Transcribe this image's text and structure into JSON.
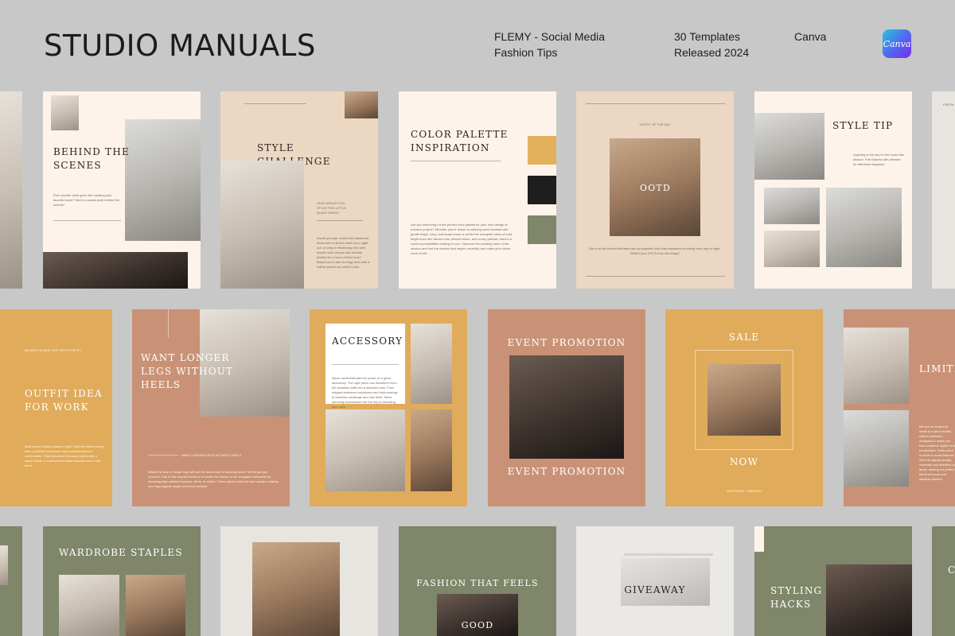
{
  "header": {
    "brand": "STUDIO MANUALS",
    "product_line1": "FLEMY - Social Media",
    "product_line2": "Fashion Tips",
    "templates": "30 Templates",
    "released": "Released 2024",
    "platform": "Canva",
    "logo_text": "Canva"
  },
  "row1": {
    "behind": {
      "title_l1": "BEHIND THE",
      "title_l2": "SCENES",
      "body": "Ever wonder what goes into creating your favorite looks? Here's a sneak peek behind the scenes!"
    },
    "style_challenge": {
      "title_l1": "STYLE",
      "title_l2": "CHALLENGE",
      "sub_l1": "HOW WOULD YOU",
      "sub_l2": "STYLE THIS LITTLE",
      "sub_l3": "BLACK DRESS",
      "body": "Would you pair it with bold statement heels and a vibrant clutch for a night out, or keep it effortlessly chic with simple nude pumps and delicate jewelry for a more refined look? Maybe you'd add an edgy twist with a leather jacket and ankle boots."
    },
    "palette": {
      "title_l1": "COLOR PALETTE",
      "title_l2": "INSPIRATION",
      "body": "Are you searching for the perfect color palette for your next design or creative project? Whether you're drawn to calming earth neutrals with gentle beige, ivory, and taupe tones or prefer the energetic vibes of bold, bright hues like vibrant reds, electric blues, and sunny yellows, there's a world of possibilities waiting for you. Discover the trending hues of the season and find the shades that inspire creativity and make your vision come to life.",
      "colors": [
        "#e3b15c",
        "#1e1e1e",
        "#7f8669"
      ]
    },
    "ootd": {
      "kicker": "OUTFIT OF THE DAY",
      "title": "OOTD",
      "body_l1": "We're all about that effortless yet put together look that transitions smoothly from day to night.",
      "body_l2": "What's your OOTD look like today?"
    },
    "style_tip": {
      "title": "STYLE TIP",
      "body": "Layering is the key to chic looks this season. Pair blazers with dresses for effortless elegance."
    },
    "partial_label": "FRESH"
  },
  "row2": {
    "outfit": {
      "kicker": "MONDAY BLUES? NOT WITH THIS FIT",
      "title_l1": "OUTFIT IDEA",
      "title_l2": "FOR WORK",
      "body": "Beat those Monday blues in style! Start the week strong with a polished look that's both professional and comfortable. Think structured trousers paired with a sleek blouse or a structured blazer layered over a chic dress."
    },
    "legs": {
      "title_l1": "WANT LONGER",
      "title_l2": "LEGS WITHOUT",
      "title_l3": "HEELS",
      "kicker": "WANT LONGER LEGS WITHOUT HEELS",
      "body": "Watch the look of longer legs without the discomfort of wearing heels? We've got you covered! One of the simplest tricks is to create the illusion of an elongated silhouette by choosing high-waisted trousers, skirts, or shorts. These pieces draw the eye upward, making your legs appear longer and more defined."
    },
    "accessory": {
      "title": "ACCESSORY",
      "body": "Never underestimate the power of a great accessory. The right piece can transform even the simplest outfit into a standout look. From elegant statement necklaces and bold earrings to timeless handbags and chic belts, these stunning accessories are the key to elevating your style."
    },
    "event": {
      "title_top": "EVENT PROMOTION",
      "title_bottom": "EVENT PROMOTION"
    },
    "sale": {
      "top": "SALE",
      "bottom": "NOW",
      "footer": "SHOP NOW · WEBSITE"
    },
    "limited": {
      "title": "LIMITE",
      "body": "We are so excited to share our latest limited edition collection designed to make you feel confident, stylish and comfortable. Each piece is made in small batches with the highest quality materials and attention to detail, making it a perfect blend of luxury and timeless fashion."
    }
  },
  "row3": {
    "wardrobe": {
      "title": "WARDROBE STAPLES"
    },
    "fashion": {
      "title_l1": "FASHION THAT FEELS",
      "title_l2": "GOOD"
    },
    "giveaway": {
      "title": "GIVEAWAY"
    },
    "styling": {
      "title_l1": "STYLING",
      "title_l2": "HACKS"
    },
    "partial_letter": "C"
  }
}
